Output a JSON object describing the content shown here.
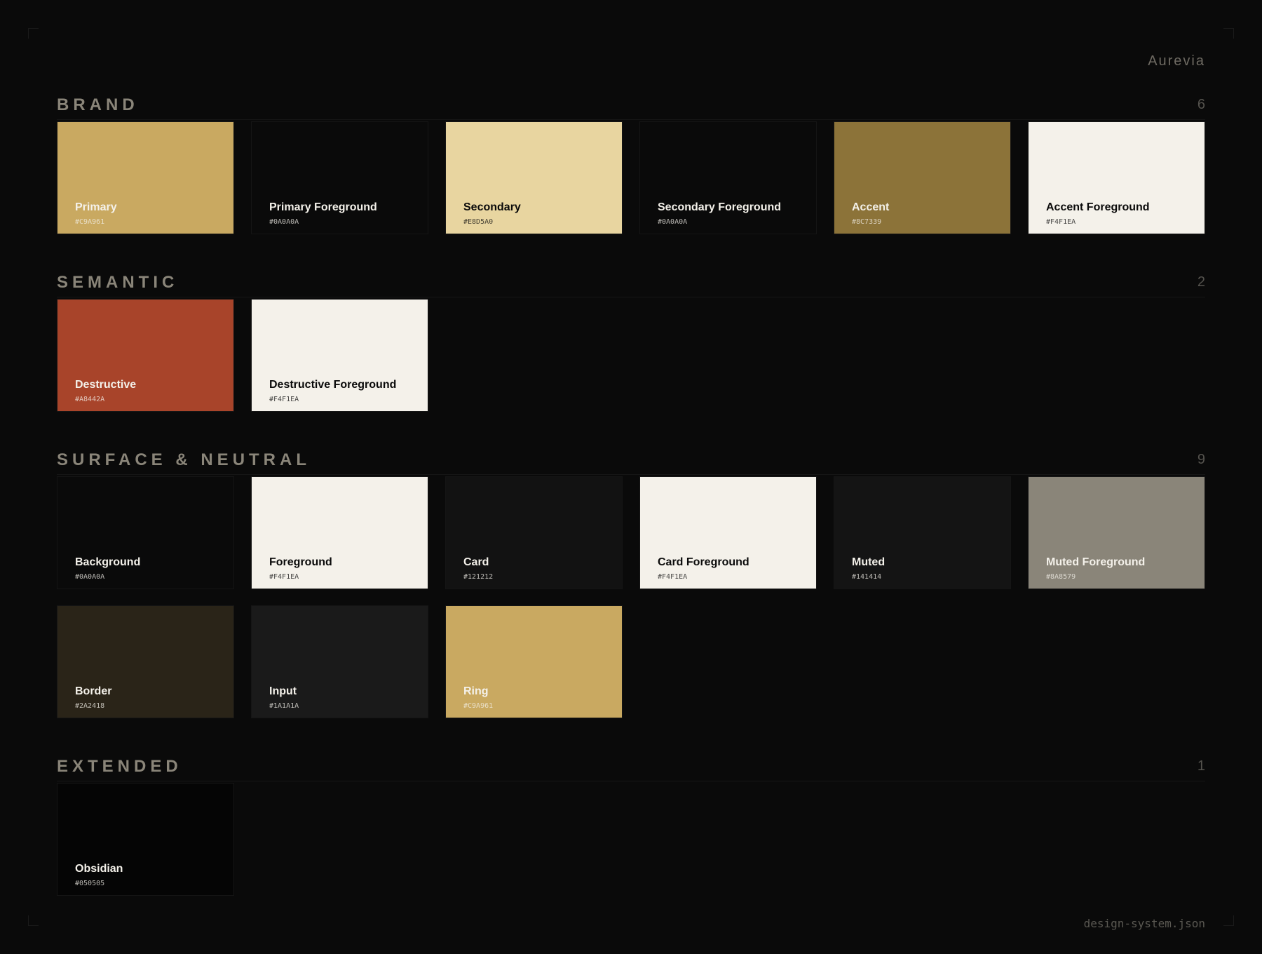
{
  "brand": "Aurevia",
  "footer": "design-system.json",
  "sections": [
    {
      "title": "BRAND",
      "count": "6",
      "swatches": [
        {
          "name": "Primary",
          "hex": "#C9A961",
          "color": "#C9A961",
          "text": "#f4f1ea"
        },
        {
          "name": "Primary Foreground",
          "hex": "#0A0A0A",
          "color": "#0A0A0A",
          "text": "#f4f1ea"
        },
        {
          "name": "Secondary",
          "hex": "#E8D5A0",
          "color": "#E8D5A0",
          "text": "#0a0a0a"
        },
        {
          "name": "Secondary Foreground",
          "hex": "#0A0A0A",
          "color": "#0A0A0A",
          "text": "#f4f1ea"
        },
        {
          "name": "Accent",
          "hex": "#8C7339",
          "color": "#8C7339",
          "text": "#f4f1ea"
        },
        {
          "name": "Accent Foreground",
          "hex": "#F4F1EA",
          "color": "#F4F1EA",
          "text": "#0a0a0a"
        }
      ]
    },
    {
      "title": "SEMANTIC",
      "count": "2",
      "swatches": [
        {
          "name": "Destructive",
          "hex": "#A8442A",
          "color": "#A8442A",
          "text": "#f4f1ea"
        },
        {
          "name": "Destructive Foreground",
          "hex": "#F4F1EA",
          "color": "#F4F1EA",
          "text": "#0a0a0a"
        }
      ]
    },
    {
      "title": "SURFACE & NEUTRAL",
      "count": "9",
      "swatches": [
        {
          "name": "Background",
          "hex": "#0A0A0A",
          "color": "#0A0A0A",
          "text": "#f4f1ea"
        },
        {
          "name": "Foreground",
          "hex": "#F4F1EA",
          "color": "#F4F1EA",
          "text": "#0a0a0a"
        },
        {
          "name": "Card",
          "hex": "#121212",
          "color": "#121212",
          "text": "#f4f1ea"
        },
        {
          "name": "Card Foreground",
          "hex": "#F4F1EA",
          "color": "#F4F1EA",
          "text": "#0a0a0a"
        },
        {
          "name": "Muted",
          "hex": "#141414",
          "color": "#141414",
          "text": "#f4f1ea"
        },
        {
          "name": "Muted Foreground",
          "hex": "#8A8579",
          "color": "#8A8579",
          "text": "#f4f1ea"
        },
        {
          "name": "Border",
          "hex": "#2A2418",
          "color": "#2A2418",
          "text": "#f4f1ea"
        },
        {
          "name": "Input",
          "hex": "#1A1A1A",
          "color": "#1A1A1A",
          "text": "#f4f1ea"
        },
        {
          "name": "Ring",
          "hex": "#C9A961",
          "color": "#C9A961",
          "text": "#f4f1ea"
        }
      ]
    },
    {
      "title": "EXTENDED",
      "count": "1",
      "swatches": [
        {
          "name": "Obsidian",
          "hex": "#050505",
          "color": "#050505",
          "text": "#f4f1ea"
        }
      ]
    }
  ]
}
